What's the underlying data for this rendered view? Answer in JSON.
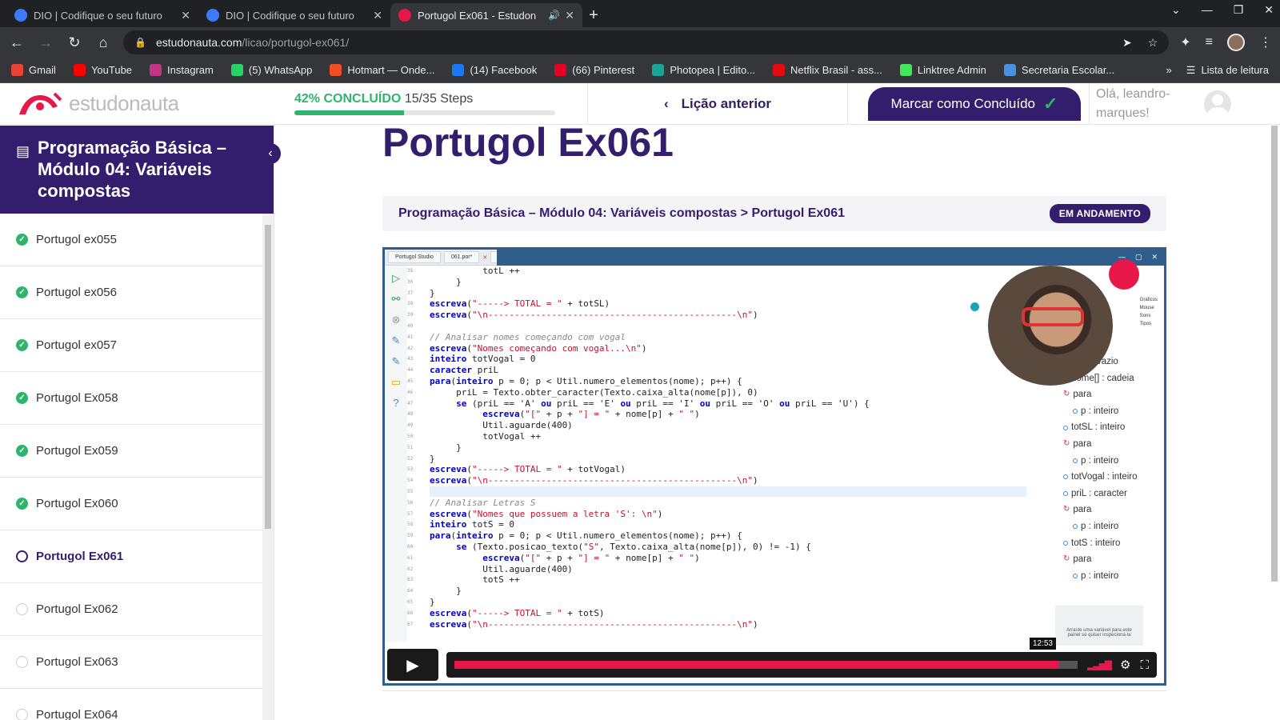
{
  "browser": {
    "tabs": [
      {
        "title": "DIO | Codifique o seu futuro",
        "color": "#3b7bf7"
      },
      {
        "title": "DIO | Codifique o seu futuro",
        "color": "#3b7bf7"
      },
      {
        "title": "Portugol Ex061 - Estudon",
        "color": "#e8174a"
      }
    ],
    "url_host": "estudonauta.com",
    "url_path": "/licao/portugol-ex061/",
    "bookmarks": [
      {
        "label": "Gmail",
        "color": "#ea4335"
      },
      {
        "label": "YouTube",
        "color": "#ff0000"
      },
      {
        "label": "Instagram",
        "color": "#c13584"
      },
      {
        "label": "(5) WhatsApp",
        "color": "#25d366"
      },
      {
        "label": "Hotmart — Onde...",
        "color": "#f04e23"
      },
      {
        "label": "(14) Facebook",
        "color": "#1877f2"
      },
      {
        "label": "(66) Pinterest",
        "color": "#e60023"
      },
      {
        "label": "Photopea | Edito...",
        "color": "#18a497"
      },
      {
        "label": "Netflix Brasil - ass...",
        "color": "#e50914"
      },
      {
        "label": "Linktree Admin",
        "color": "#43e55e"
      },
      {
        "label": "Secretaria Escolar...",
        "color": "#4a90e2"
      }
    ],
    "reading_list": "Lista de leitura"
  },
  "header": {
    "logo": "estudonauta",
    "progress_pct": "42% CONCLUÍDO",
    "progress_steps": "15/35 Steps",
    "progress_fraction": 0.42,
    "prev_lesson": "Lição anterior",
    "mark_complete": "Marcar como Concluído",
    "greeting": "Olá, leandro-marques!"
  },
  "sidebar": {
    "course_title": "Programação Básica – Módulo 04: Variáveis compostas",
    "lessons": [
      {
        "label": "Portugol ex055",
        "status": "done"
      },
      {
        "label": "Portugol ex056",
        "status": "done"
      },
      {
        "label": "Portugol ex057",
        "status": "done"
      },
      {
        "label": "Portugol Ex058",
        "status": "done"
      },
      {
        "label": "Portugol Ex059",
        "status": "done"
      },
      {
        "label": "Portugol Ex060",
        "status": "done"
      },
      {
        "label": "Portugol Ex061",
        "status": "current"
      },
      {
        "label": "Portugol Ex062",
        "status": "todo"
      },
      {
        "label": "Portugol Ex063",
        "status": "todo"
      },
      {
        "label": "Portugol Ex064",
        "status": "todo"
      }
    ]
  },
  "main": {
    "title": "Portugol Ex061",
    "breadcrumb": "Programação Básica – Módulo 04: Variáveis compostas > Portugol Ex061",
    "badge": "EM ANDAMENTO"
  },
  "video": {
    "ide_tabs": [
      "Portugol Studio",
      "061.por*"
    ],
    "time": "12:53",
    "progress_fraction": 0.97,
    "hint": "Arraste uma variável para este painel se quiser inspecioná-la",
    "mini_panel": [
      "Gráficos",
      "Mouse",
      "Sons",
      "Tipos"
    ],
    "code_lines": [
      "          totL ++",
      "     }",
      "}",
      "escreva(\"-----> TOTAL = \" + totSL)",
      "escreva(\"\\n-----------------------------------------------\\n\")",
      "",
      "// Analisar nomes começando com vogal",
      "escreva(\"Nomes começando com vogal...\\n\")",
      "inteiro totVogal = 0",
      "caracter priL",
      "para(inteiro p = 0; p < Util.numero_elementos(nome); p++) {",
      "     priL = Texto.obter_caracter(Texto.caixa_alta(nome[p]), 0)",
      "     se (priL == 'A' ou priL == 'E' ou priL == 'I' ou priL == 'O' ou priL == 'U') {",
      "          escreva(\"[\" + p + \"] = \" + nome[p] + \" \")",
      "          Util.aguarde(400)",
      "          totVogal ++",
      "     }",
      "}",
      "escreva(\"-----> TOTAL = \" + totVogal)",
      "escreva(\"\\n-----------------------------------------------\\n\")",
      "",
      "// Analisar Letras S",
      "escreva(\"Nomes que possuem a letra 'S': \\n\")",
      "inteiro totS = 0",
      "para(inteiro p = 0; p < Util.numero_elementos(nome); p++) {",
      "     se (Texto.posicao_texto(\"S\", Texto.caixa_alta(nome[p]), 0) != -1) {",
      "          escreva(\"[\" + p + \"] = \" + nome[p] + \" \")",
      "          Util.aguarde(400)",
      "          totS ++",
      "     }",
      "}",
      "escreva(\"-----> TOTAL = \" + totS)",
      "escreva(\"\\n-----------------------------------------------\\n\")"
    ],
    "line_numbers": [
      "35",
      "36",
      "37",
      "38",
      "39",
      "40",
      "41",
      "42",
      "43",
      "44",
      "45",
      "46",
      "47",
      "48",
      "49",
      "50",
      "51",
      "52",
      "53",
      "54",
      "55",
      "56",
      "57",
      "58",
      "59",
      "60",
      "61",
      "62",
      "63",
      "64",
      "65",
      "66",
      "67"
    ],
    "tree": [
      {
        "label": "cio() : vazio",
        "kind": "fn"
      },
      {
        "label": "nome[] : cadeia",
        "kind": "var"
      },
      {
        "label": "para",
        "kind": "loop"
      },
      {
        "label": "p : inteiro",
        "kind": "var"
      },
      {
        "label": "totSL : inteiro",
        "kind": "var"
      },
      {
        "label": "para",
        "kind": "loop"
      },
      {
        "label": "p : inteiro",
        "kind": "var"
      },
      {
        "label": "totVogal : inteiro",
        "kind": "var"
      },
      {
        "label": "priL : caracter",
        "kind": "var"
      },
      {
        "label": "para",
        "kind": "loop"
      },
      {
        "label": "p : inteiro",
        "kind": "var"
      },
      {
        "label": "totS : inteiro",
        "kind": "var"
      },
      {
        "label": "para",
        "kind": "loop"
      },
      {
        "label": "p : inteiro",
        "kind": "var"
      }
    ]
  },
  "icons": {
    "back": "arrow-left-icon",
    "forward": "arrow-right-icon",
    "reload": "reload-icon",
    "home": "home-icon",
    "book": "book-icon",
    "play": "play-icon",
    "settings": "gear-icon",
    "fullscreen": "fullscreen-icon"
  }
}
